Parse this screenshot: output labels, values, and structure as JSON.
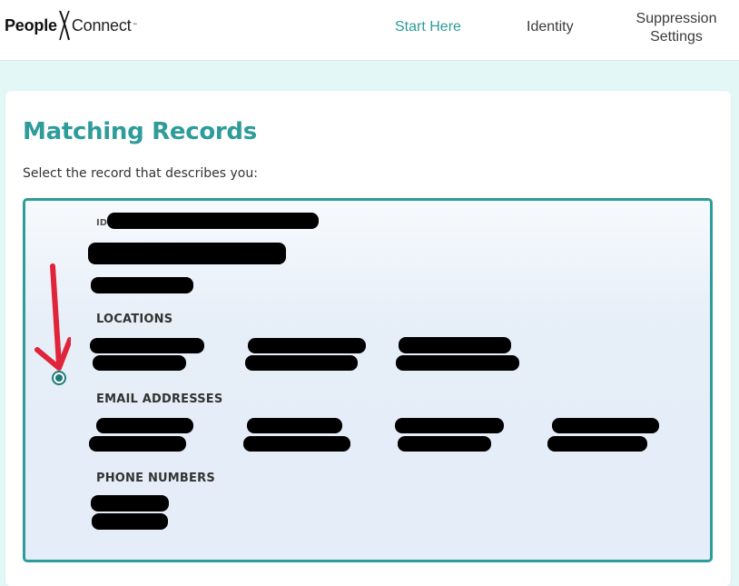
{
  "header": {
    "logo": {
      "people": "People",
      "connect": "Connect",
      "tm": "™"
    },
    "nav": {
      "start_here": "Start Here",
      "identity": "Identity",
      "suppression_line1": "Suppression",
      "suppression_line2": "Settings"
    }
  },
  "main": {
    "title": "Matching Records",
    "subtitle": "Select the record that describes you:",
    "record": {
      "id_label": "ID:",
      "selected": true,
      "sections": {
        "locations": "LOCATIONS",
        "emails": "EMAIL ADDRESSES",
        "phones": "PHONE NUMBERS"
      }
    }
  },
  "colors": {
    "accent": "#2e9c9a",
    "page_background": "#e3f7f6",
    "arrow": "#e0243a"
  },
  "icons": {
    "radio": "radio-selected-icon",
    "arrow": "red-arrow-annotation-icon"
  }
}
